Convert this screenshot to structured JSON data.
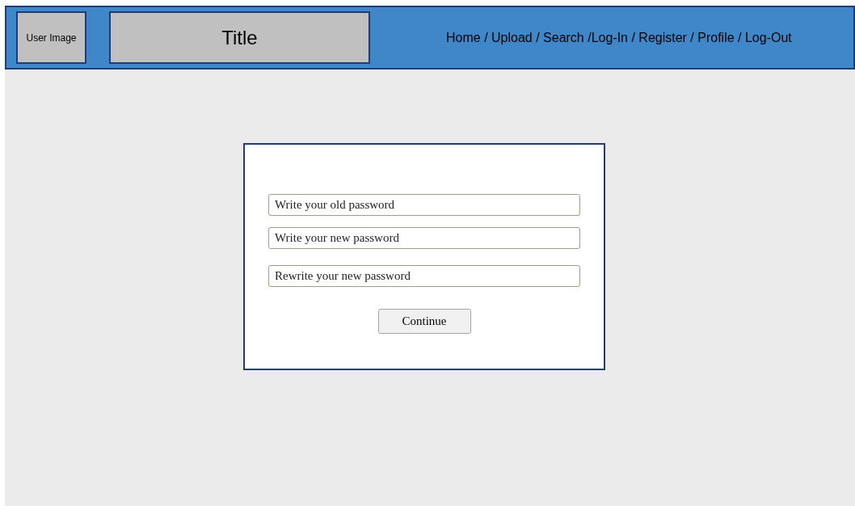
{
  "header": {
    "user_image": "User Image",
    "title": "Title",
    "nav": "Home / Upload / Search /Log-In / Register / Profile / Log-Out"
  },
  "form": {
    "fields": [
      {
        "placeholder": "Write your old password"
      },
      {
        "placeholder": "Write your new password"
      },
      {
        "placeholder": "Rewrite your new password"
      }
    ],
    "button": "Continue"
  }
}
